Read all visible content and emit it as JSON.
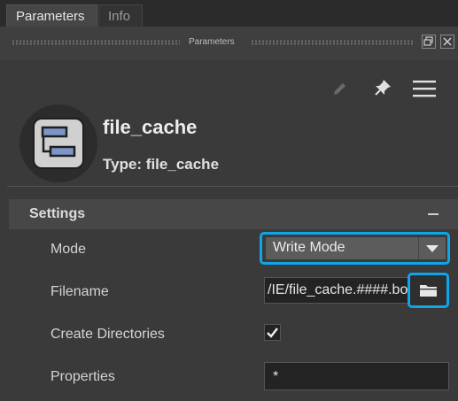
{
  "tabs": [
    {
      "label": "Parameters",
      "active": true
    },
    {
      "label": "Info",
      "active": false
    }
  ],
  "panel": {
    "title": "Parameters",
    "toolbar_icons": [
      "pencil-icon",
      "pin-icon",
      "menu-icon"
    ]
  },
  "node": {
    "name": "file_cache",
    "type_label": "Type: file_cache",
    "icon": "file-cache-node-icon"
  },
  "section": {
    "title": "Settings",
    "collapse_icon": "minus-icon"
  },
  "params": {
    "mode": {
      "label": "Mode",
      "value": "Write Mode"
    },
    "filename": {
      "label": "Filename",
      "value": "/IE/file_cache.####.bob"
    },
    "create_directories": {
      "label": "Create Directories",
      "checked": true
    },
    "properties": {
      "label": "Properties",
      "value": "*"
    }
  },
  "colors": {
    "highlight": "#0ea5e9",
    "background": "#3a3a3a",
    "section": "#474747",
    "field": "#232323"
  }
}
